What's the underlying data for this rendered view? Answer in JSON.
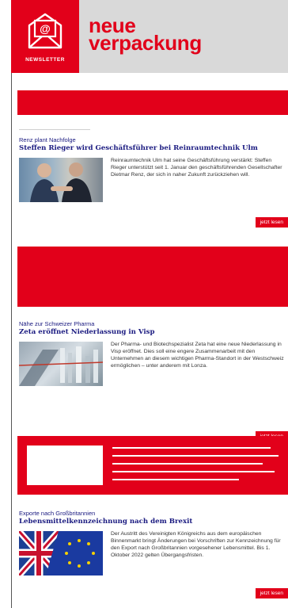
{
  "header": {
    "badge_label": "NEWSLETTER",
    "brand_line1": "neue",
    "brand_line2": "verpackung",
    "accent_color": "#e2001a"
  },
  "articles": [
    {
      "kicker": "Renz plant Nachfolge",
      "headline": "Steffen Rieger wird Geschäftsführer bei Reinraumtechnik Ulm",
      "excerpt": "Reinraumtechnik Ulm hat seine Geschäftsführung verstärkt: Steffen Rieger unterstützt seit 1. Januar den geschäftsführenden Gesellschafter Dietmar Renz, der sich in naher Zukunft zurückziehen will.",
      "button": "jetzt lesen",
      "image": "two-men-portrait-image"
    },
    {
      "kicker": "Nähe zur Schweizer Pharma",
      "headline": "Zeta eröffnet Niederlassung in Visp",
      "excerpt": "Der Pharma- und Biotechspezialist Zeta hat eine neue Niederlassung in Visp eröffnet. Dies soll eine engere Zusammenarbeit mit den Unternehmen an diesem wichtigen Pharma-Standort in der Westschweiz ermöglichen – unter anderem mit Lonza.",
      "button": "jetzt lesen",
      "image": "pharma-plant-image"
    },
    {
      "kicker": "Exporte nach Großbritannien",
      "headline": "Lebensmittelkennzeichnung nach dem Brexit",
      "excerpt": "Der Austritt des Vereinigten Königreichs aus dem europäischen Binnenmarkt bringt Änderungen bei Vorschriften zur Kennzeichnung für den Export nach Großbritannien vorgesehener Lebensmittel. Bis 1. Oktober 2022 gelten Übergangsfristen.",
      "button": "jetzt lesen",
      "image": "union-jack-eu-flag-image"
    }
  ]
}
